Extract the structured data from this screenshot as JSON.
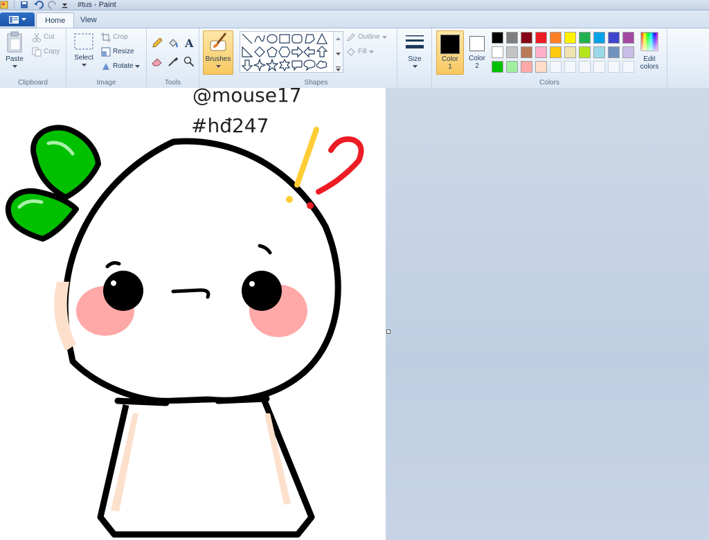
{
  "window": {
    "title": "#tus - Paint"
  },
  "tabs": {
    "home": "Home",
    "view": "View"
  },
  "clipboard": {
    "paste": "Paste",
    "cut": "Cut",
    "copy": "Copy",
    "group": "Clipboard"
  },
  "image": {
    "select": "Select",
    "crop": "Crop",
    "resize": "Resize",
    "rotate": "Rotate",
    "group": "Image"
  },
  "tools": {
    "group": "Tools"
  },
  "brushes": {
    "label": "Brushes"
  },
  "shapes": {
    "outline": "Outline",
    "fill": "Fill",
    "group": "Shapes"
  },
  "size": {
    "label": "Size"
  },
  "colors": {
    "color1_label": "Color",
    "color1_num": "1",
    "color2_label": "Color",
    "color2_num": "2",
    "edit_label": "Edit",
    "edit_label2": "colors",
    "group": "Colors",
    "color1_value": "#000000",
    "color2_value": "#ffffff",
    "row1": [
      "#000000",
      "#7f7f7f",
      "#880015",
      "#ed1c24",
      "#ff7f27",
      "#fff200",
      "#22b14c",
      "#00a2e8",
      "#3f48cc",
      "#a349a4"
    ],
    "row2": [
      "#ffffff",
      "#c3c3c3",
      "#b97a57",
      "#ffaec9",
      "#ffc90e",
      "#efe4b0",
      "#b5e61d",
      "#99d9ea",
      "#7092be",
      "#c8bfe7"
    ],
    "row3": [
      "#00c000",
      "#a0f0a0",
      "#ffa8a8",
      "#ffdcc8",
      "",
      "",
      "",
      "",
      "",
      ""
    ]
  },
  "canvas": {
    "text_line1": "@mouse17",
    "text_line2": "#hđ247"
  }
}
